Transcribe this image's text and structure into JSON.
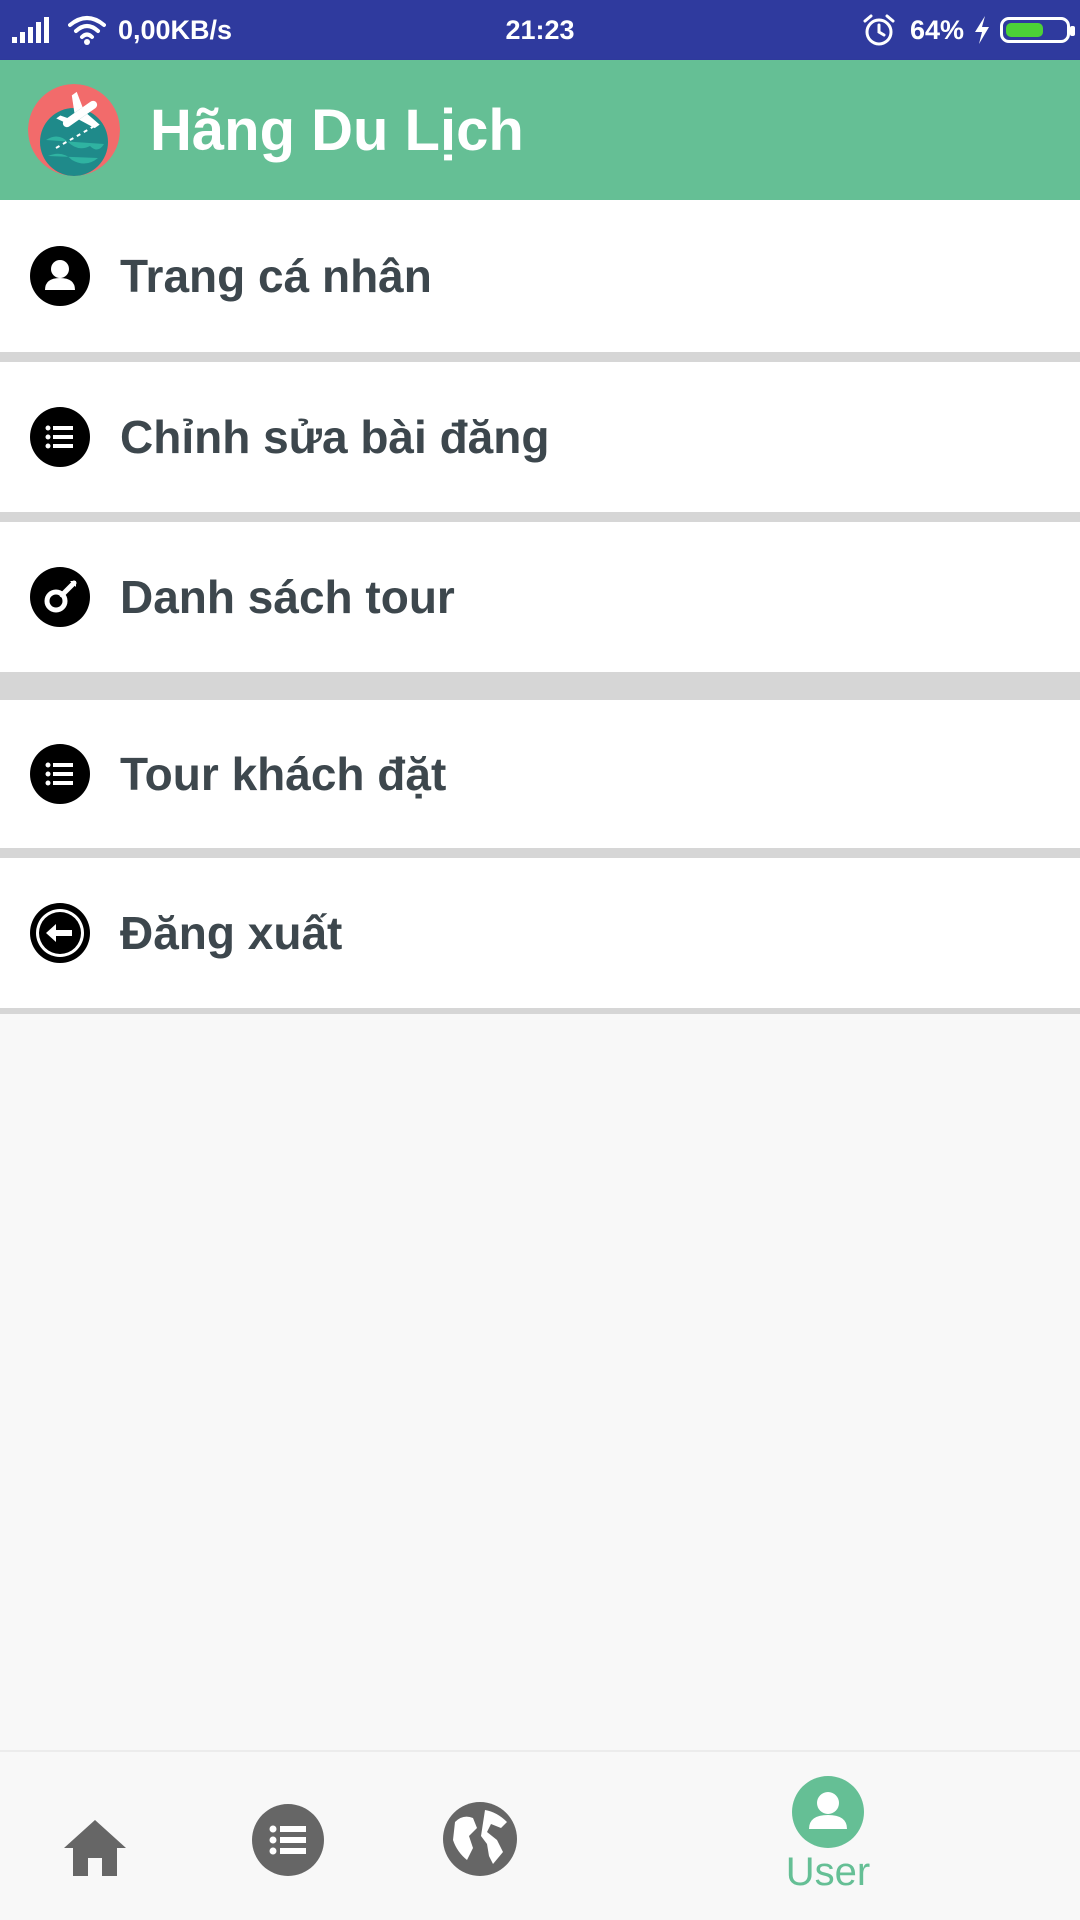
{
  "status_bar": {
    "network_speed": "0,00KB/s",
    "time": "21:23",
    "battery_percent": "64%",
    "battery_level": 0.64,
    "icons": [
      "signal-icon",
      "wifi-icon",
      "alarm-icon",
      "charging-icon",
      "battery-icon"
    ]
  },
  "app_bar": {
    "title": "Hãng Du Lịch",
    "logo": "travel-globe-airplane-logo"
  },
  "menu": {
    "items": [
      {
        "label": "Trang cá nhân",
        "icon": "person-icon"
      },
      {
        "label": "Chỉnh sửa bài đăng",
        "icon": "list-icon"
      },
      {
        "label": "Danh sách tour",
        "icon": "compass-icon"
      },
      {
        "label": "Tour khách đặt",
        "icon": "list-icon"
      },
      {
        "label": "Đăng xuất",
        "icon": "logout-icon"
      }
    ]
  },
  "bottom_nav": {
    "items": [
      {
        "icon": "home-icon",
        "label": ""
      },
      {
        "icon": "list-icon",
        "label": ""
      },
      {
        "icon": "globe-icon",
        "label": ""
      },
      {
        "icon": "user-icon",
        "label": "User",
        "active": true
      }
    ],
    "active_color": "#65bf95",
    "inactive_color": "#666666"
  },
  "colors": {
    "status_bar": "#2f3a9e",
    "app_bar": "#65bf95",
    "text": "#3d474d",
    "separator": "#d6d6d6"
  }
}
